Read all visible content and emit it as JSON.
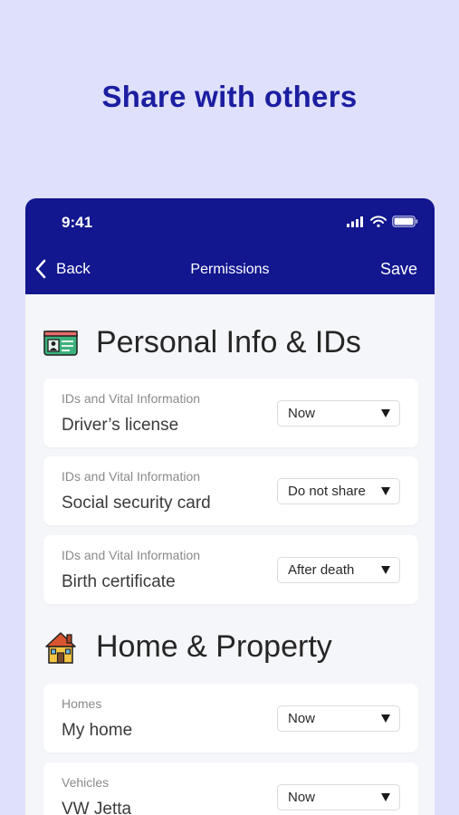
{
  "headline": "Share with others",
  "status": {
    "time": "9:41"
  },
  "nav": {
    "back_label": "Back",
    "title": "Permissions",
    "save_label": "Save"
  },
  "sections": [
    {
      "title": "Personal Info & IDs",
      "icon": "id-card-icon",
      "items": [
        {
          "category": "IDs and Vital Information",
          "title": "Driver’s license",
          "permission": "Now"
        },
        {
          "category": "IDs and Vital Information",
          "title": "Social security card",
          "permission": "Do not share"
        },
        {
          "category": "IDs and Vital Information",
          "title": "Birth certificate",
          "permission": "After death"
        }
      ]
    },
    {
      "title": "Home & Property",
      "icon": "house-icon",
      "items": [
        {
          "category": "Homes",
          "title": "My home",
          "permission": "Now"
        },
        {
          "category": "Vehicles",
          "title": "VW Jetta",
          "permission": "Now"
        }
      ]
    }
  ],
  "colors": {
    "background": "#dfe0fb",
    "brand": "#12168f",
    "headline": "#1b1ea0"
  }
}
